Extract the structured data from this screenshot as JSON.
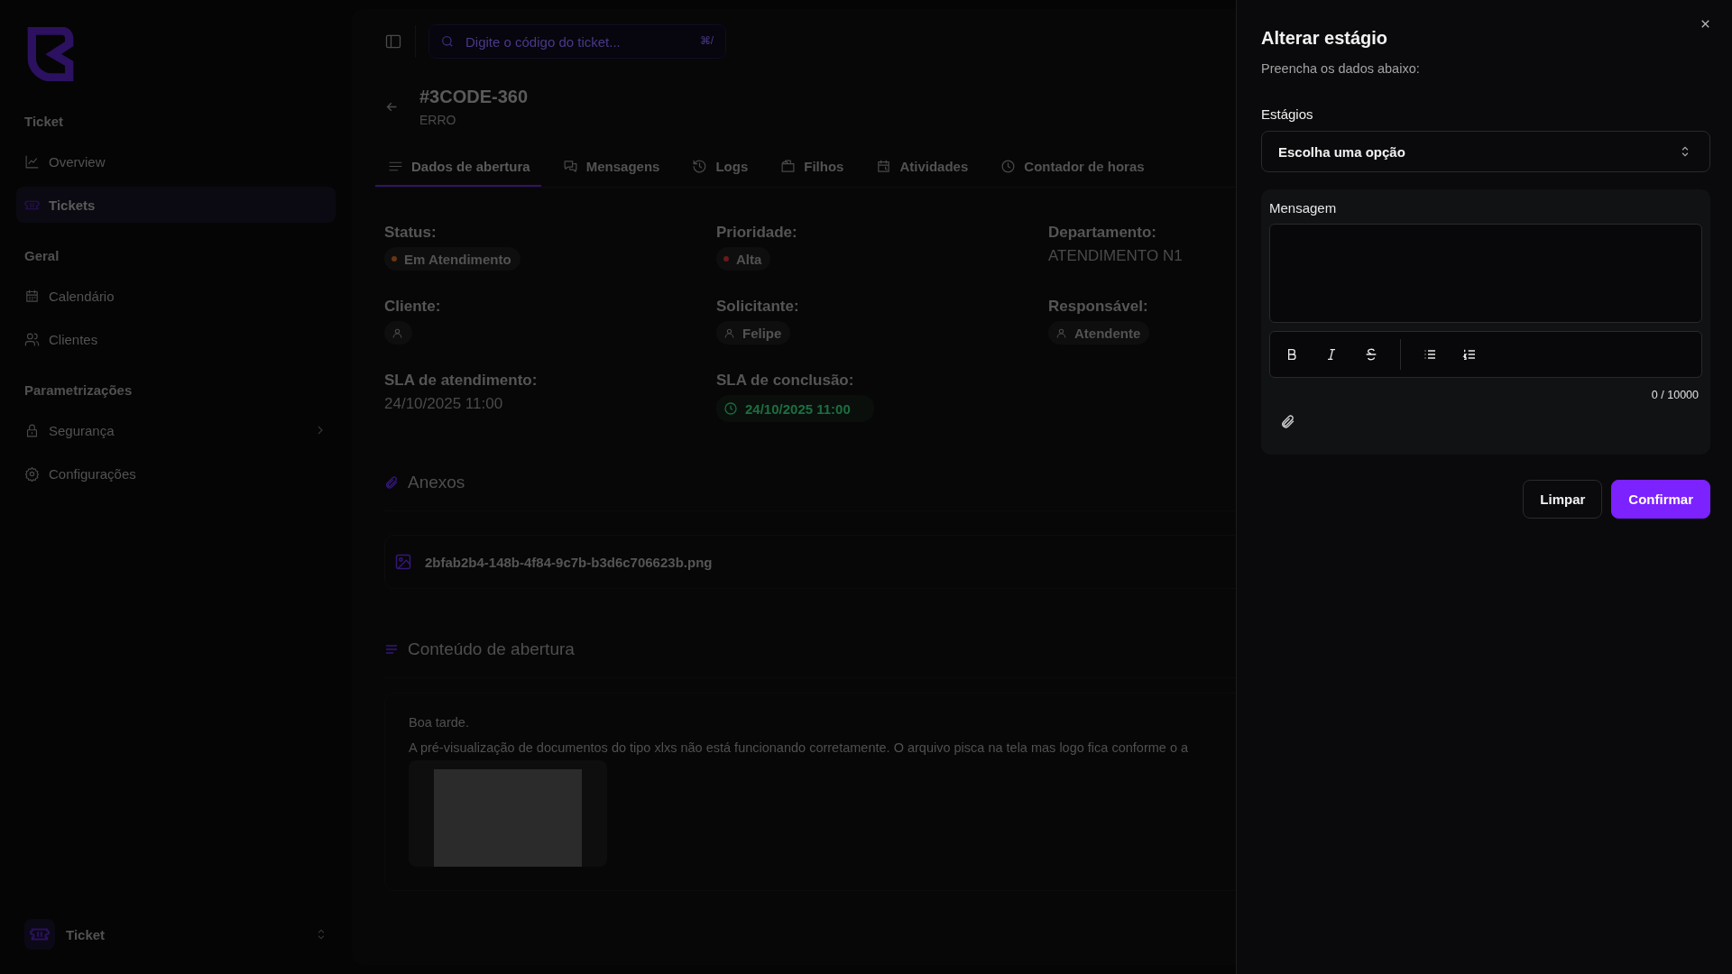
{
  "sidebar": {
    "sections": [
      {
        "title": "Ticket",
        "items": [
          {
            "label": "Overview",
            "selected": false,
            "expandable": false
          },
          {
            "label": "Tickets",
            "selected": true,
            "expandable": false
          }
        ]
      },
      {
        "title": "Geral",
        "items": [
          {
            "label": "Calendário",
            "selected": false,
            "expandable": false
          },
          {
            "label": "Clientes",
            "selected": false,
            "expandable": false
          }
        ]
      },
      {
        "title": "Parametrizações",
        "items": [
          {
            "label": "Segurança",
            "selected": false,
            "expandable": true
          },
          {
            "label": "Configurações",
            "selected": false,
            "expandable": false
          }
        ]
      }
    ],
    "workspace": {
      "label": "Ticket"
    }
  },
  "search": {
    "placeholder": "Digite o código do ticket...",
    "shortcut": "⌘/"
  },
  "ticket": {
    "code": "#3CODE-360",
    "type": "ERRO"
  },
  "tabs": [
    {
      "label": "Dados de abertura",
      "selected": true
    },
    {
      "label": "Mensagens",
      "selected": false
    },
    {
      "label": "Logs",
      "selected": false
    },
    {
      "label": "Filhos",
      "selected": false
    },
    {
      "label": "Atividades",
      "selected": false
    },
    {
      "label": "Contador de horas",
      "selected": false
    }
  ],
  "fields": [
    {
      "label": "Status:",
      "kind": "badge",
      "value": "Em Atendimento",
      "color": "#6b3412"
    },
    {
      "label": "Prioridade:",
      "kind": "badge",
      "value": "Alta",
      "color": "#6a1a1a"
    },
    {
      "label": "Departamento:",
      "kind": "text",
      "value": "ATENDIMENTO N1"
    },
    {
      "label": "Cliente:",
      "kind": "person"
    },
    {
      "label": "Solicitante:",
      "kind": "person",
      "value": "Felipe"
    },
    {
      "label": "Responsável:",
      "kind": "person",
      "value": "Atendente"
    },
    {
      "label": "SLA de atendimento:",
      "kind": "text",
      "value": "24/10/2025 11:00"
    },
    {
      "label": "SLA de conclusão:",
      "kind": "deadline",
      "value": "24/10/2025 11:00"
    }
  ],
  "attachments": {
    "title": "Anexos",
    "files": [
      "2bfab2b4-148b-4f84-9c7b-b3d6c706623b.png"
    ]
  },
  "content": {
    "title": "Conteúdo de abertura",
    "paragraphs": [
      "Boa tarde.",
      "A pré-visualização de documentos do tipo xlxs não está funcionando corretamente. O arquivo pisca na tela mas logo fica conforme o a"
    ]
  },
  "sheet": {
    "title": "Alterar estágio",
    "subtitle": "Preencha os dados abaixo:",
    "select": {
      "label": "Estágios",
      "placeholder": "Escolha uma opção"
    },
    "message": {
      "label": "Mensagem",
      "counter": "0 / 10000"
    },
    "buttons": [
      {
        "label": "Limpar",
        "kind": "secondary"
      },
      {
        "label": "Confirmar",
        "kind": "primary"
      }
    ]
  }
}
